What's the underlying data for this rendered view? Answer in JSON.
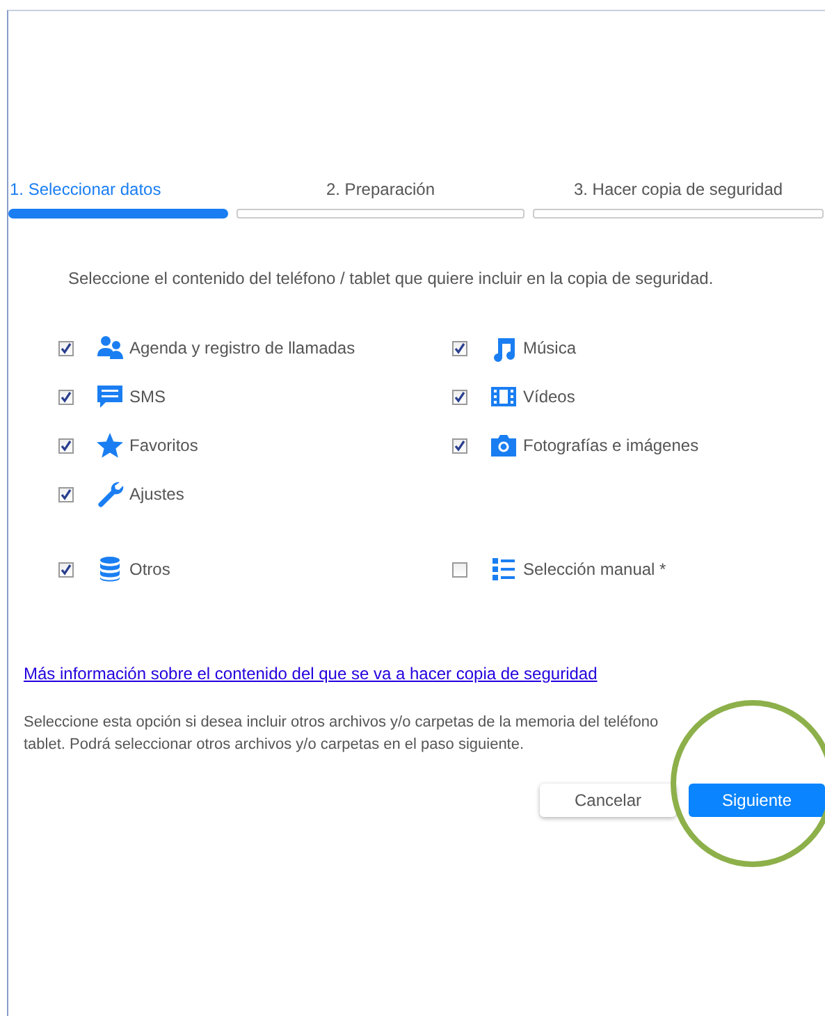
{
  "steps": [
    {
      "label": "1. Seleccionar datos",
      "selected": true
    },
    {
      "label": "2. Preparación",
      "selected": false
    },
    {
      "label": "3. Hacer copia de seguridad",
      "selected": false
    }
  ],
  "instruction": "Seleccione el contenido del teléfono / tablet que quiere incluir en la copia de seguridad.",
  "options": [
    {
      "label": "Agenda y registro de llamadas",
      "checked": true
    },
    {
      "label": "Música",
      "checked": true
    },
    {
      "label": "SMS",
      "checked": true
    },
    {
      "label": "Vídeos",
      "checked": true
    },
    {
      "label": "Favoritos",
      "checked": true
    },
    {
      "label": "Fotografías e imágenes",
      "checked": true
    },
    {
      "label": "Ajustes",
      "checked": true
    }
  ],
  "extra_options": [
    {
      "label": "Otros",
      "checked": true
    },
    {
      "label": "Selección manual *",
      "checked": false
    }
  ],
  "info_link": "Más información sobre el contenido del que se va a hacer copia de seguridad",
  "note_lines": [
    "Seleccione esta opción si desea incluir otros archivos y/o carpetas de la memoria del teléfono",
    "tablet. Podrá seleccionar otros archivos y/o carpetas en el paso siguiente."
  ],
  "buttons": [
    {
      "label": "Cancelar",
      "kind": "secondary"
    },
    {
      "label": "Siguiente",
      "kind": "primary"
    }
  ]
}
